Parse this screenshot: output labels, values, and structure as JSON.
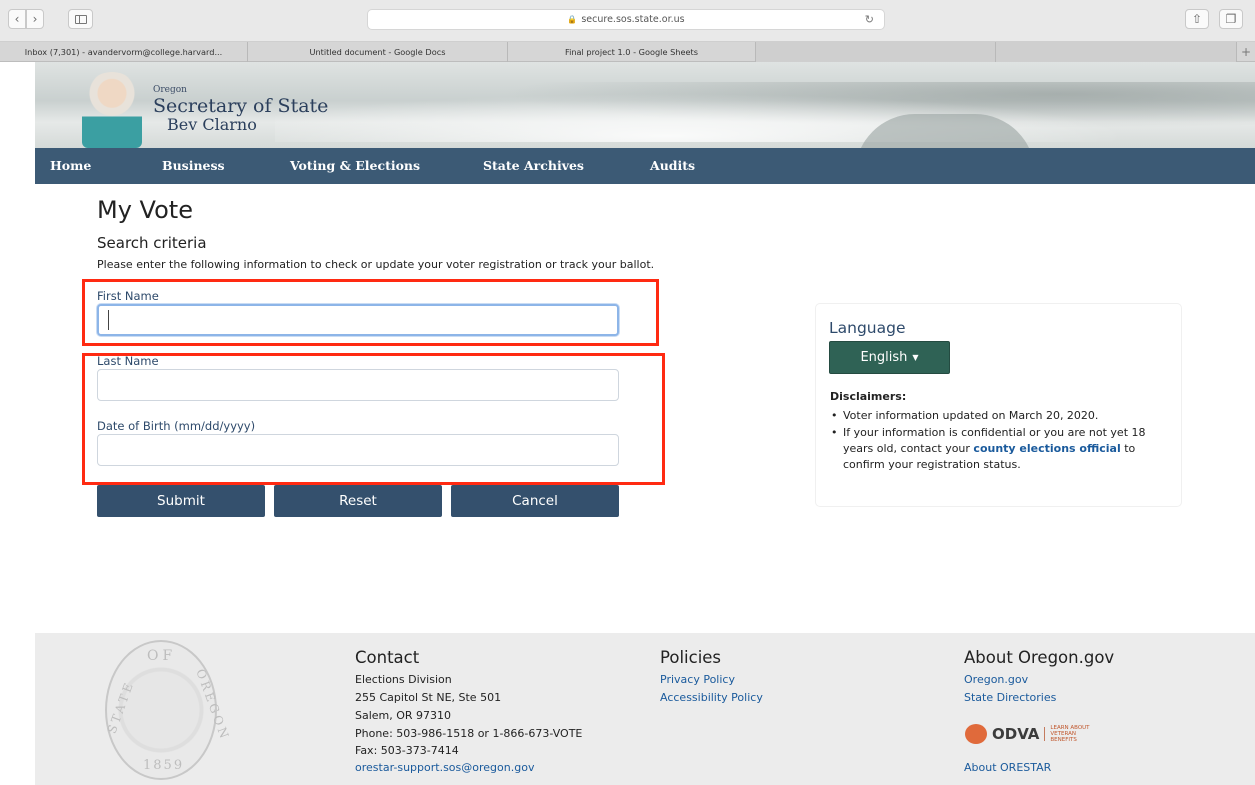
{
  "browser": {
    "url": "secure.sos.state.or.us",
    "tabs": [
      {
        "label": "Inbox (7,301) - avandervorm@college.harvard..."
      },
      {
        "label": "Untitled document - Google Docs"
      },
      {
        "label": "Final project 1.0 - Google Sheets"
      }
    ],
    "icons": {
      "back": "chevron-left-icon",
      "forward": "chevron-right-icon",
      "sidebar": "sidebar-icon",
      "lock": "lock-icon",
      "reload": "reload-icon",
      "share": "share-icon",
      "tabs_overview": "tabs-overview-icon",
      "new_tab": "plus-icon"
    }
  },
  "header": {
    "state_small": "Oregon",
    "office": "Secretary of State",
    "name": "Bev Clarno"
  },
  "nav": {
    "items": [
      {
        "label": "Home"
      },
      {
        "label": "Business"
      },
      {
        "label": "Voting & Elections"
      },
      {
        "label": "State Archives"
      },
      {
        "label": "Audits"
      }
    ]
  },
  "main": {
    "title": "My Vote",
    "section_title": "Search criteria",
    "instructions": "Please enter the following information to check or update your voter registration or track your ballot.",
    "fields": {
      "first_name": {
        "label": "First Name",
        "value": ""
      },
      "last_name": {
        "label": "Last Name",
        "value": ""
      },
      "dob": {
        "label": "Date of Birth (mm/dd/yyyy)",
        "value": ""
      }
    },
    "buttons": {
      "submit": "Submit",
      "reset": "Reset",
      "cancel": "Cancel"
    }
  },
  "language_panel": {
    "title": "Language",
    "selected_language": "English",
    "disclaimers_title": "Disclaimers:",
    "disclaimer_1": "Voter information updated on March 20, 2020.",
    "disclaimer_2_before": "If your information is confidential or you are not yet 18 years old, contact your ",
    "disclaimer_2_link": "county elections official",
    "disclaimer_2_after": " to confirm your registration status."
  },
  "footer": {
    "seal": {
      "top": "OF",
      "left": "STATE",
      "right": "OREGON",
      "year": "1859"
    },
    "contact": {
      "heading": "Contact",
      "lines": [
        "Elections Division",
        "255 Capitol St NE, Ste 501",
        "Salem, OR 97310",
        "Phone: 503-986-1518 or 1-866-673-VOTE",
        "Fax: 503-373-7414"
      ],
      "email": "orestar-support.sos@oregon.gov"
    },
    "policies": {
      "heading": "Policies",
      "links": [
        "Privacy Policy",
        "Accessibility Policy"
      ]
    },
    "about": {
      "heading": "About Oregon.gov",
      "links": [
        "Oregon.gov",
        "State Directories"
      ],
      "odva_word": "ODVA",
      "odva_tagline": "LEARN ABOUT VETERAN BENEFITS",
      "orestar_link": "About ORESTAR"
    }
  },
  "colors": {
    "nav_bg": "#3c5a75",
    "button_bg": "#34506d",
    "language_button_bg": "#2f6255",
    "highlight": "#ff2a12",
    "link": "#1a5a9c"
  }
}
